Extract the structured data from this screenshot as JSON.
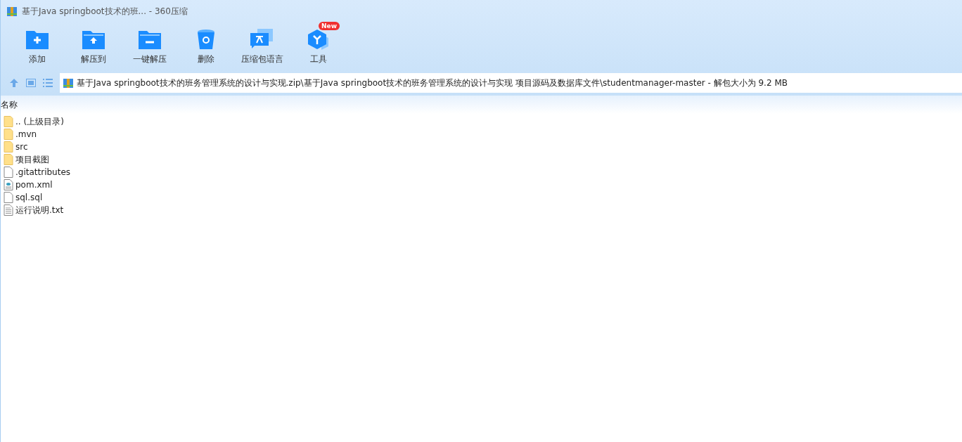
{
  "window": {
    "title": "基于Java springboot技术的班... - 360压缩"
  },
  "toolbar": [
    {
      "kind": "add",
      "label": "添加"
    },
    {
      "kind": "extract-to",
      "label": "解压到"
    },
    {
      "kind": "extract",
      "label": "一键解压"
    },
    {
      "kind": "delete",
      "label": "删除"
    },
    {
      "kind": "language",
      "label": "压缩包语言"
    },
    {
      "kind": "tools",
      "label": "工具",
      "badge": "New"
    }
  ],
  "address": {
    "path": "基于Java springboot技术的班务管理系统的设计与实现.zip\\基于Java springboot技术的班务管理系统的设计与实现 项目源码及数据库文件\\studentmanager-master - 解包大小为 9.2 MB"
  },
  "table": {
    "columns": [
      "名称"
    ],
    "rows": [
      {
        "kind": "folder",
        "name": ".. (上级目录)"
      },
      {
        "kind": "folder",
        "name": ".mvn"
      },
      {
        "kind": "folder",
        "name": "src"
      },
      {
        "kind": "folder",
        "name": "项目截图"
      },
      {
        "kind": "file",
        "name": ".gitattributes"
      },
      {
        "kind": "xml",
        "name": "pom.xml"
      },
      {
        "kind": "file",
        "name": "sql.sql"
      },
      {
        "kind": "text",
        "name": "运行说明.txt"
      }
    ]
  }
}
